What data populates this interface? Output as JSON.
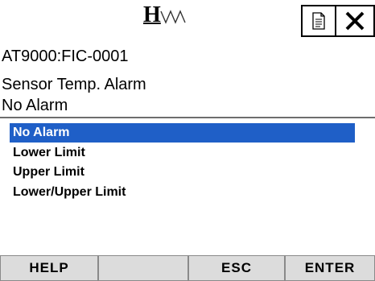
{
  "header": {
    "logo_letter": "H",
    "doc_icon": "document-icon",
    "close_icon": "close-icon"
  },
  "device": {
    "tag": "AT9000:FIC-0001"
  },
  "parameter": {
    "label": "Sensor Temp. Alarm",
    "current_value": "No Alarm"
  },
  "options": [
    {
      "label": "No Alarm",
      "selected": true
    },
    {
      "label": "Lower Limit",
      "selected": false
    },
    {
      "label": "Upper Limit",
      "selected": false
    },
    {
      "label": "Lower/Upper Limit",
      "selected": false
    }
  ],
  "softkeys": {
    "f1": "HELP",
    "f2": "",
    "f3": "ESC",
    "f4": "ENTER"
  },
  "colors": {
    "selection": "#1f5fc7",
    "softkey_bg": "#dcdcdc"
  }
}
